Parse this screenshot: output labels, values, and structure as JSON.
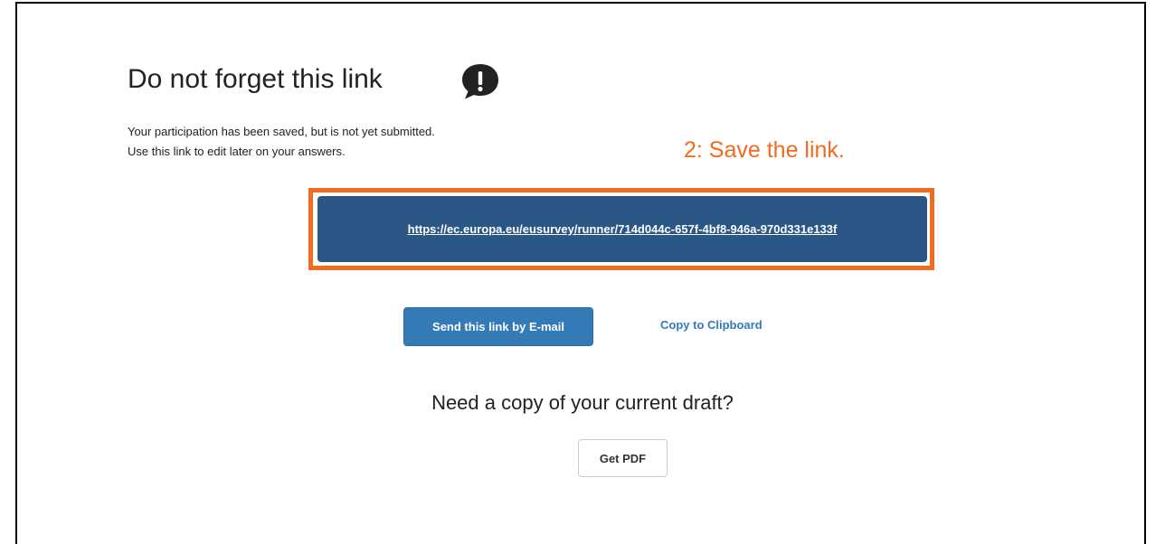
{
  "page": {
    "title": "Do not forget this link",
    "title_icon": "exclamation-speech-bubble-icon",
    "message_line1": "Your participation has been saved, but is not yet submitted.",
    "message_line2": "Use this link to edit later on your answers.",
    "annotation": "2: Save the link.",
    "draft_link": "https://ec.europa.eu/eusurvey/runner/714d044c-657f-4bf8-946a-970d331e133f",
    "email_button_label": "Send this link by E-mail",
    "clipboard_label": "Copy to Clipboard",
    "draft_question": "Need a copy of your current draft?",
    "pdf_button_label": "Get PDF"
  },
  "colors": {
    "annotation": "#f26b21",
    "link_box_bg": "#2a5786",
    "primary_button": "#337ab7"
  }
}
